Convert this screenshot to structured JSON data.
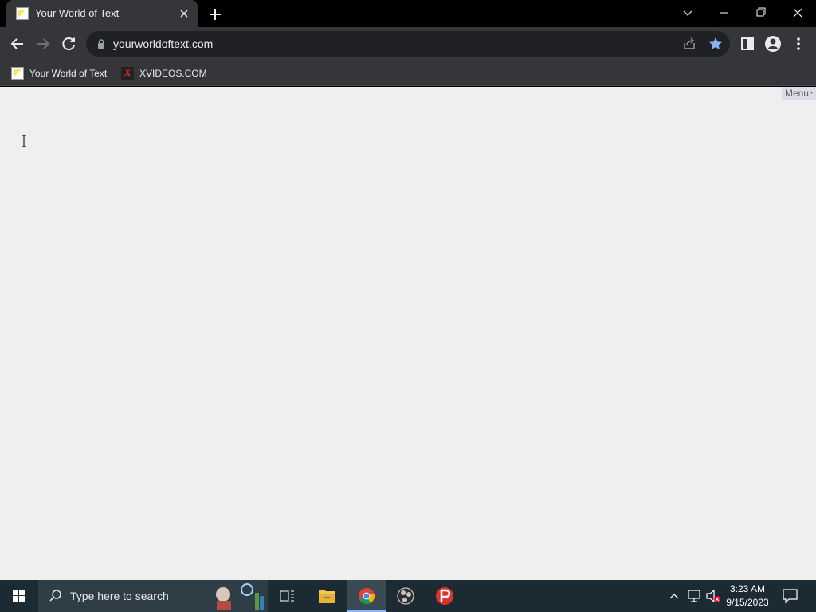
{
  "browser": {
    "tab": {
      "title": "Your World of Text",
      "close_icon": "close-icon"
    },
    "new_tab_icon": "plus-icon",
    "window_controls": [
      "minimize-icon",
      "restore-icon",
      "close-icon"
    ],
    "toolbar": {
      "url": "yourworldoftext.com"
    },
    "bookmarks": [
      {
        "label": "Your World of Text",
        "icon": "yw-favicon"
      },
      {
        "label": "XVIDEOS.COM",
        "icon": "x-favicon",
        "icon_glyph": "X"
      }
    ]
  },
  "page": {
    "menu_label": "Menu",
    "menu_arrow": "▾",
    "background": "#efefef"
  },
  "taskbar": {
    "search_placeholder": "Type here to search",
    "apps": [
      "task-view-icon",
      "file-explorer-icon",
      "chrome-icon",
      "obs-icon",
      "psiphon-icon"
    ],
    "time": "3:23 AM",
    "date": "9/15/2023"
  },
  "colors": {
    "titlebar": "#000000",
    "toolbar": "#35363a",
    "omnibox": "#202124",
    "star": "#8ab4f8",
    "taskbar": "#1c2b33"
  }
}
